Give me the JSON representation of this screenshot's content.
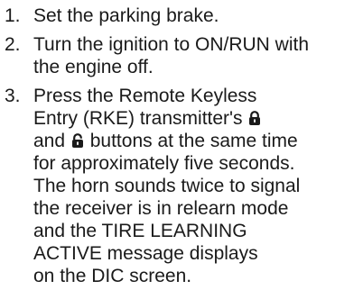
{
  "steps": [
    {
      "number": "1.",
      "text": "Set the parking brake."
    },
    {
      "number": "2.",
      "text": "Turn the ignition to ON/RUN with\nthe engine off."
    },
    {
      "number": "3.",
      "text_before_lock": "Press the Remote Keyless\nEntry (RKE) transmitter's",
      "lock_icon": "lock-icon",
      "text_middle": "\nand",
      "unlock_icon": "unlock-icon",
      "text_after_unlock": "buttons at the same time\nfor approximately five seconds.\nThe horn sounds twice to signal\nthe receiver is in relearn mode\nand the TIRE LEARNING\nACTIVE message displays\non the DIC screen."
    }
  ]
}
